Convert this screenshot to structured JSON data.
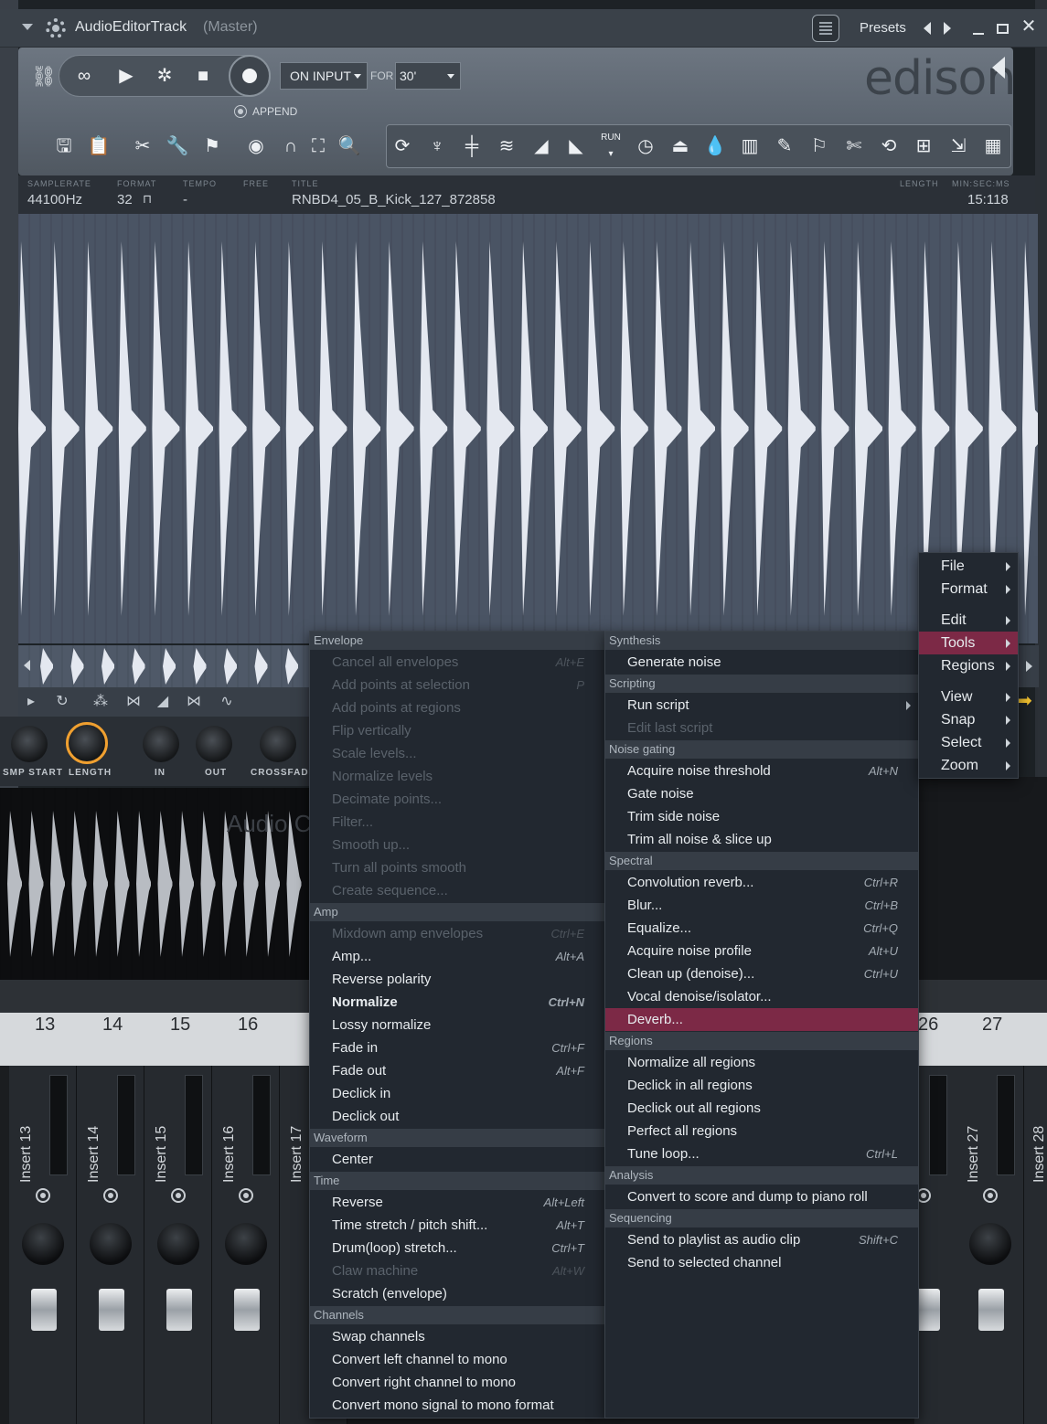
{
  "window": {
    "title": "AudioEditorTrack",
    "subtitle": "(Master)",
    "presets_label": "Presets"
  },
  "recorder": {
    "mode": "ON INPUT",
    "for_label": "FOR",
    "for_value": "30'",
    "append_label": "APPEND",
    "logo": "edison"
  },
  "info": {
    "samplerate_label": "SAMPLERATE",
    "samplerate": "44100Hz",
    "format_label": "FORMAT",
    "format": "32",
    "tempo_label": "TEMPO",
    "tempo": "-",
    "free_label": "FREE",
    "title_label": "TITLE",
    "title": "RNBD4_05_B_Kick_127_872858",
    "length_label": "LENGTH",
    "minsecms_label": "MIN:SEC:MS",
    "length": "15:118"
  },
  "knobs": {
    "smp_start": "SMP START",
    "length": "LENGTH",
    "in": "IN",
    "out": "OUT",
    "crossfade": "CROSSFADE"
  },
  "clip_label": "Audio C",
  "mixer": {
    "track_numbers": [
      "13",
      "14",
      "15",
      "16",
      "26",
      "27"
    ],
    "inserts": [
      "Insert 13",
      "Insert 14",
      "Insert 15",
      "Insert 16",
      "Insert 17",
      "Insert 27",
      "Insert 28"
    ]
  },
  "menu_left": {
    "sections": {
      "envelope": "Envelope",
      "amp": "Amp",
      "waveform": "Waveform",
      "time": "Time",
      "channels": "Channels"
    },
    "items": [
      {
        "label": "Cancel all envelopes",
        "shortcut": "Alt+E",
        "disabled": true
      },
      {
        "label": "Add points at selection",
        "shortcut": "P",
        "disabled": true
      },
      {
        "label": "Add points at regions",
        "shortcut": "",
        "disabled": true
      },
      {
        "label": "Flip vertically",
        "shortcut": "",
        "disabled": true
      },
      {
        "label": "Scale levels...",
        "shortcut": "",
        "disabled": true
      },
      {
        "label": "Normalize levels",
        "shortcut": "",
        "disabled": true
      },
      {
        "label": "Decimate points...",
        "shortcut": "",
        "disabled": true
      },
      {
        "label": "Filter...",
        "shortcut": "",
        "disabled": true
      },
      {
        "label": "Smooth up...",
        "shortcut": "",
        "disabled": true
      },
      {
        "label": "Turn all points smooth",
        "shortcut": "",
        "disabled": true
      },
      {
        "label": "Create sequence...",
        "shortcut": "",
        "disabled": true
      },
      {
        "label": "Mixdown amp envelopes",
        "shortcut": "Ctrl+E",
        "disabled": true
      },
      {
        "label": "Amp...",
        "shortcut": "Alt+A",
        "disabled": false
      },
      {
        "label": "Reverse polarity",
        "shortcut": "",
        "disabled": false
      },
      {
        "label": "Normalize",
        "shortcut": "Ctrl+N",
        "disabled": false
      },
      {
        "label": "Lossy normalize",
        "shortcut": "",
        "disabled": false
      },
      {
        "label": "Fade in",
        "shortcut": "Ctrl+F",
        "disabled": false
      },
      {
        "label": "Fade out",
        "shortcut": "Alt+F",
        "disabled": false
      },
      {
        "label": "Declick in",
        "shortcut": "",
        "disabled": false
      },
      {
        "label": "Declick out",
        "shortcut": "",
        "disabled": false
      },
      {
        "label": "Center",
        "shortcut": "",
        "disabled": false
      },
      {
        "label": "Reverse",
        "shortcut": "Alt+Left",
        "disabled": false
      },
      {
        "label": "Time stretch / pitch shift...",
        "shortcut": "Alt+T",
        "disabled": false
      },
      {
        "label": "Drum(loop) stretch...",
        "shortcut": "Ctrl+T",
        "disabled": false
      },
      {
        "label": "Claw machine",
        "shortcut": "Alt+W",
        "disabled": true
      },
      {
        "label": "Scratch (envelope)",
        "shortcut": "",
        "disabled": false
      },
      {
        "label": "Swap channels",
        "shortcut": "",
        "disabled": false
      },
      {
        "label": "Convert left channel to mono",
        "shortcut": "",
        "disabled": false
      },
      {
        "label": "Convert right channel to mono",
        "shortcut": "",
        "disabled": false
      },
      {
        "label": "Convert mono signal to mono format",
        "shortcut": "",
        "disabled": false
      }
    ]
  },
  "menu_mid": {
    "sections": {
      "synthesis": "Synthesis",
      "scripting": "Scripting",
      "noise_gating": "Noise gating",
      "spectral": "Spectral",
      "regions": "Regions",
      "analysis": "Analysis",
      "sequencing": "Sequencing"
    },
    "items": [
      {
        "label": "Generate noise",
        "shortcut": ""
      },
      {
        "label": "Run script",
        "shortcut": ""
      },
      {
        "label": "Edit last script",
        "shortcut": ""
      },
      {
        "label": "Acquire noise threshold",
        "shortcut": "Alt+N"
      },
      {
        "label": "Gate noise",
        "shortcut": ""
      },
      {
        "label": "Trim side noise",
        "shortcut": ""
      },
      {
        "label": "Trim all noise & slice up",
        "shortcut": ""
      },
      {
        "label": "Convolution reverb...",
        "shortcut": "Ctrl+R"
      },
      {
        "label": "Blur...",
        "shortcut": "Ctrl+B"
      },
      {
        "label": "Equalize...",
        "shortcut": "Ctrl+Q"
      },
      {
        "label": "Acquire noise profile",
        "shortcut": "Alt+U"
      },
      {
        "label": "Clean up (denoise)...",
        "shortcut": "Ctrl+U"
      },
      {
        "label": "Vocal denoise/isolator...",
        "shortcut": ""
      },
      {
        "label": "Deverb...",
        "shortcut": ""
      },
      {
        "label": "Normalize all regions",
        "shortcut": ""
      },
      {
        "label": "Declick in all regions",
        "shortcut": ""
      },
      {
        "label": "Declick out all regions",
        "shortcut": ""
      },
      {
        "label": "Perfect all regions",
        "shortcut": ""
      },
      {
        "label": "Tune loop...",
        "shortcut": "Ctrl+L"
      },
      {
        "label": "Convert to score and dump to piano roll",
        "shortcut": ""
      },
      {
        "label": "Send to playlist as audio clip",
        "shortcut": "Shift+C"
      },
      {
        "label": "Send to selected channel",
        "shortcut": ""
      }
    ]
  },
  "menu_right": {
    "items": [
      "File",
      "Format",
      "Edit",
      "Tools",
      "Regions",
      "View",
      "Snap",
      "Select",
      "Zoom"
    ]
  },
  "colors": {
    "highlight": "#7c2946",
    "wave_bg": "#4a5464",
    "wave_fg": "#e4e8f0",
    "accent_knob": "#f0a030"
  }
}
